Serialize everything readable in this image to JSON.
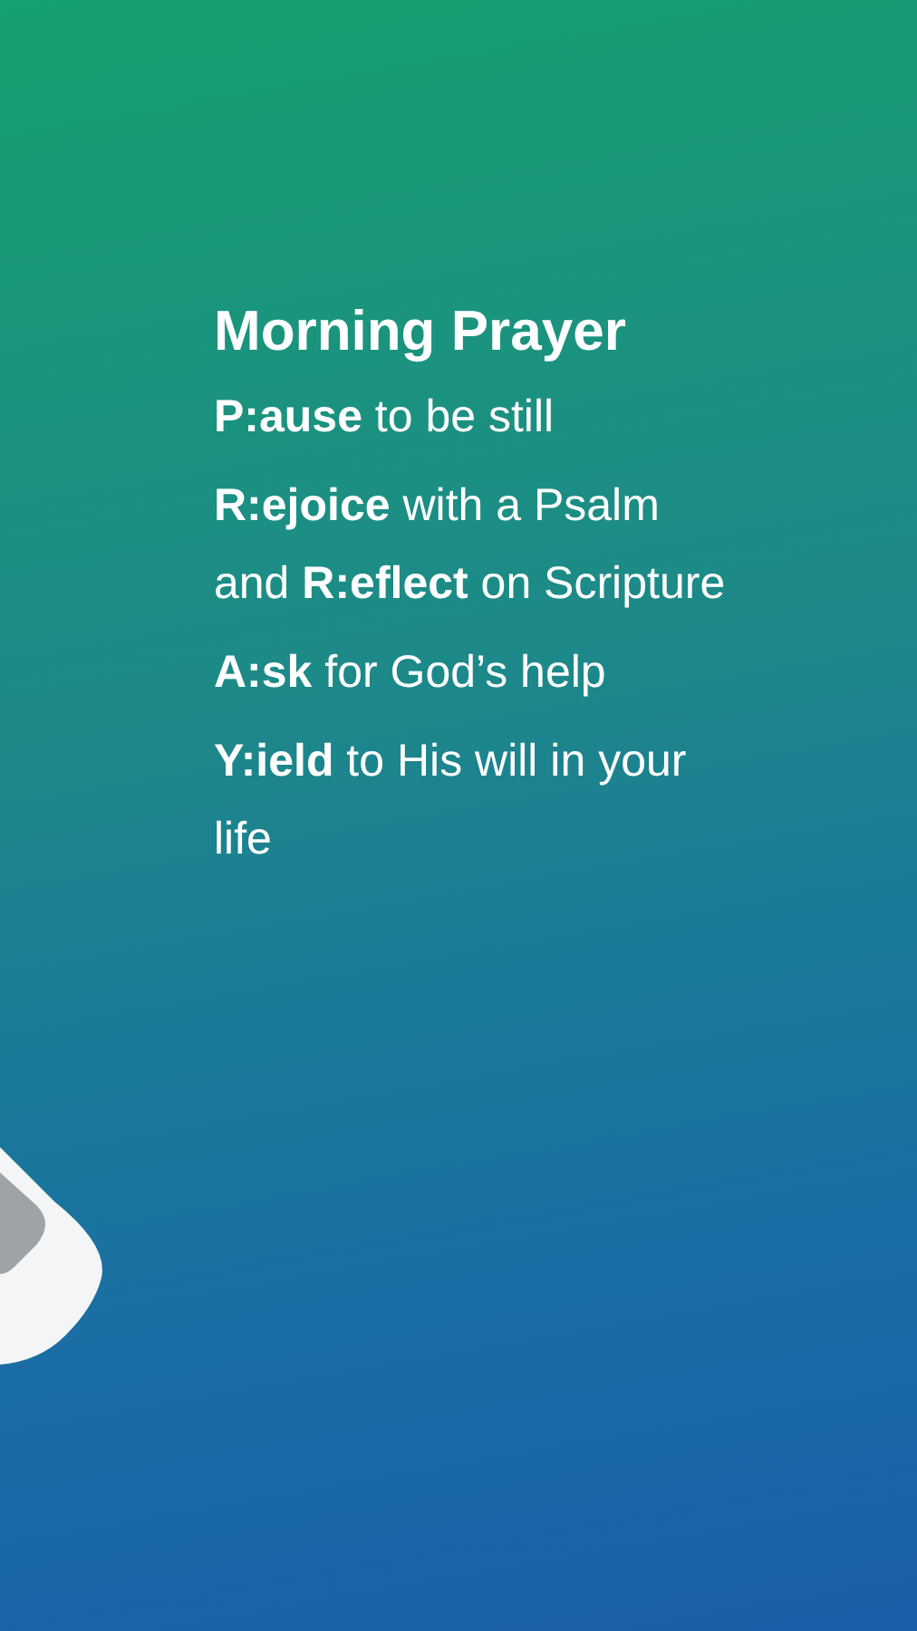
{
  "title": "Morning Prayer",
  "steps": [
    {
      "text": "**P:ause** to be still"
    },
    {
      "text": "**R:ejoice** with a Psalm and **R:eflect** on Scripture"
    },
    {
      "text": "**A:sk** for God’s help"
    },
    {
      "text": "**Y:ield** to His will in your life"
    }
  ]
}
